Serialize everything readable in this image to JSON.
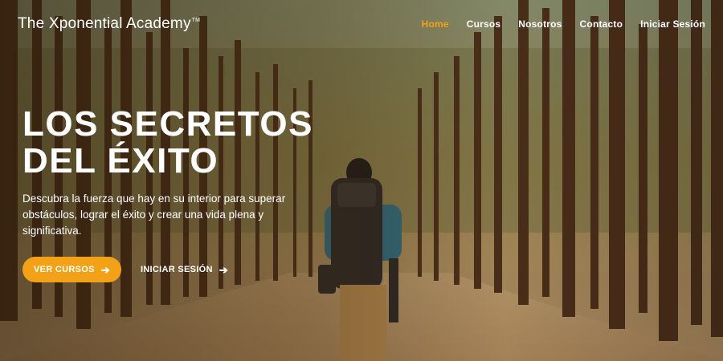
{
  "brand": {
    "name": "The Xponential Academy",
    "trademark": "TM"
  },
  "nav": {
    "items": [
      {
        "label": "Home",
        "active": true
      },
      {
        "label": "Cursos",
        "active": false
      },
      {
        "label": "Nosotros",
        "active": false
      },
      {
        "label": "Contacto",
        "active": false
      },
      {
        "label": "Iniciar Sesión",
        "active": false
      }
    ]
  },
  "hero": {
    "headline_line1": "LOS SECRETOS",
    "headline_line2": "DEL ÉXITO",
    "subtitle": "Descubra la fuerza que hay en su interior para superar obstáculos, lograr el éxito y crear una vida plena y significativa.",
    "primary_button": "VER CURSOS",
    "secondary_button": "INICIAR SESIÓN",
    "arrow_icon": "arrow-right-icon"
  },
  "colors": {
    "accent": "#f3a116",
    "text": "#ffffff"
  }
}
